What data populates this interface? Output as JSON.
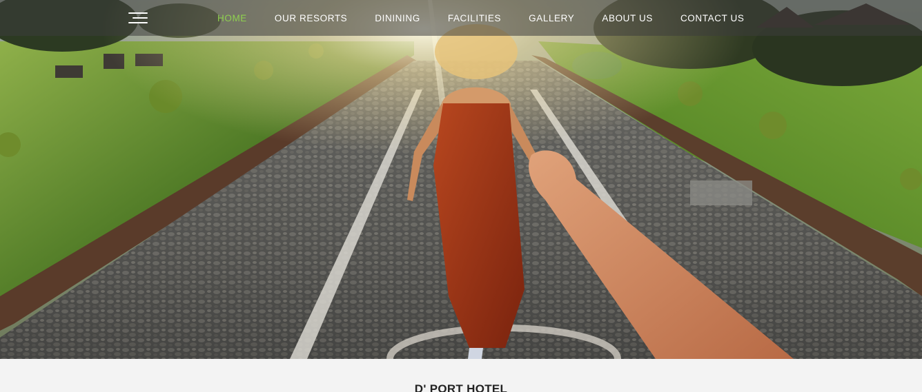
{
  "nav": {
    "menu_icon": "hamburger-menu-icon",
    "active_color": "#8fd14f",
    "items": [
      {
        "label": "HOME",
        "active": true
      },
      {
        "label": "OUR RESORTS",
        "active": false
      },
      {
        "label": "DININING",
        "active": false
      },
      {
        "label": "FACILITIES",
        "active": false
      },
      {
        "label": "GALLERY",
        "active": false
      },
      {
        "label": "ABOUT US",
        "active": false
      },
      {
        "label": "CONTACT US",
        "active": false
      }
    ]
  },
  "hero": {
    "alt": "Woman in red dress leading by the hand along a pebble garden path"
  },
  "intro": {
    "title": "D' PORT HOTEL"
  }
}
